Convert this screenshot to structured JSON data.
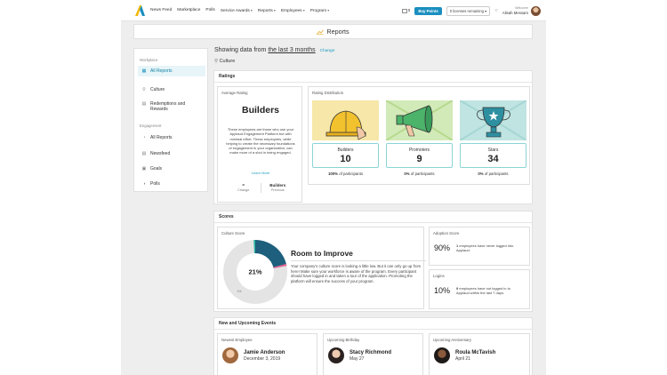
{
  "topbar": {
    "nav": [
      "News Feed",
      "Marketplace",
      "Polls",
      "Service Awards",
      "Reports",
      "Employees",
      "Program"
    ],
    "nav_dropdown": [
      false,
      false,
      false,
      true,
      true,
      true,
      true
    ],
    "cart_count": "0",
    "buy_label": "Buy Points",
    "licenses_label": "0 licenses remaining",
    "user_subtitle": "Welcome",
    "user_name": "Alisah Messam"
  },
  "page_title": "Reports",
  "sidebar": {
    "workplace_heading": "Workplace",
    "workplace_items": [
      {
        "label": "All Reports",
        "icon": "report-icon",
        "active": true
      },
      {
        "label": "Culture",
        "icon": "pin-icon",
        "active": false
      },
      {
        "label": "Redemptions and Rewards",
        "icon": "gift-icon",
        "active": false
      }
    ],
    "engagement_heading": "Engagement",
    "engagement_items": [
      {
        "label": "All Reports",
        "icon": "pie-icon"
      },
      {
        "label": "Newsfeed",
        "icon": "feed-icon"
      },
      {
        "label": "Goals",
        "icon": "goal-icon"
      },
      {
        "label": "Polls",
        "icon": "poll-icon"
      }
    ]
  },
  "filter": {
    "prefix": "Showing data from",
    "range": "the last 3 months",
    "change": "Change",
    "category": "Culture"
  },
  "ratings": {
    "title": "Ratings",
    "average": {
      "title": "Average Rating",
      "name": "Builders",
      "description": "These employees are those who use your Applaud Engagement Platform but with minimal effort. These employees, while helping to create the necessary foundations of engagement in your organization, can make more of a shot in being engaged.",
      "learn_more": "Learn More",
      "change_value": "=",
      "change_label": "Change",
      "previous_value": "Builders",
      "previous_label": "Previous"
    },
    "distribution": {
      "title": "Rating Distribution",
      "tiles": [
        {
          "name": "Builders",
          "value": "10",
          "pct": "100%",
          "suffix": "of participants",
          "bg": "#f7e7a8"
        },
        {
          "name": "Promoters",
          "value": "9",
          "pct": "0%",
          "suffix": "of participants",
          "bg": "#d2eab8"
        },
        {
          "name": "Stars",
          "value": "34",
          "pct": "0%",
          "suffix": "of participants",
          "bg": "#bfe4e2"
        }
      ]
    }
  },
  "scores": {
    "title": "Scores",
    "culture": {
      "title": "Culture Score",
      "center": "21%",
      "small_label": "1%",
      "fraction": 0.21,
      "heading": "Room to Improve",
      "description": "Your company's culture score is looking a little low. But it can only go up from here! Make sure your workforce is aware of the program. Every participant should have logged in and taken a tour of the application. Promoting the platform will ensure the success of your program."
    },
    "adoption": {
      "title": "Adoption Score",
      "value": "90%",
      "count": "1",
      "text": "employees have never logged into Applaud."
    },
    "logins": {
      "title": "Logins",
      "value": "10%",
      "count": "9",
      "text": "employees have not logged in to Applaud within the last 7 days."
    }
  },
  "events": {
    "title": "New and Upcoming Events",
    "items": [
      {
        "title": "Newest Employee",
        "name": "Jamie Anderson",
        "date": "December 3, 2019"
      },
      {
        "title": "Upcoming Birthday",
        "name": "Stacy Richmond",
        "date": "May 27"
      },
      {
        "title": "Upcoming Anniversary",
        "name": "Roula McTavish",
        "date": "April 21"
      }
    ]
  },
  "colors": {
    "accent": "#1a8fbf",
    "donut_main": "#1d5f7c",
    "donut_rest": "#e4e4e4",
    "donut_pink": "#e0608f",
    "donut_teal": "#2ab7a0",
    "active_bg": "#e7f5f8"
  }
}
